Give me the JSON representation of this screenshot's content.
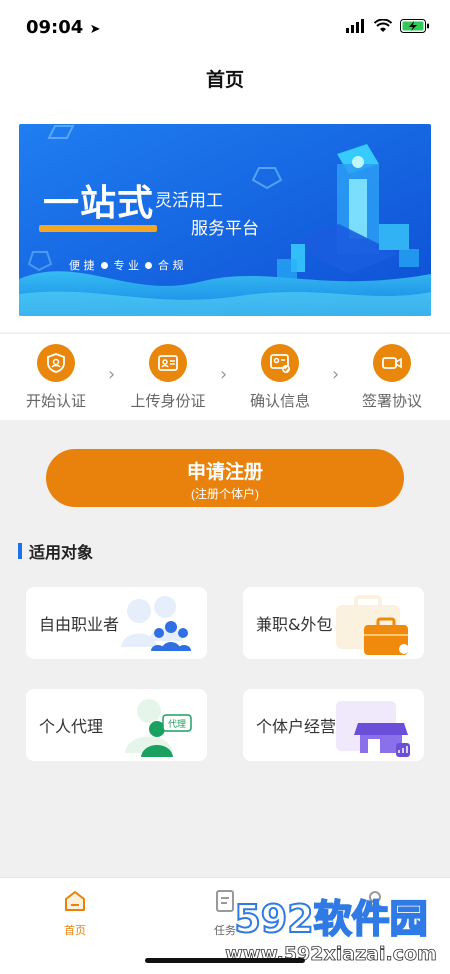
{
  "status_bar": {
    "time": "09:04"
  },
  "header": {
    "title": "首页"
  },
  "banner": {
    "headline": "一站式",
    "line1": "灵活用工",
    "line2": "服务平台",
    "tags": [
      "便 捷",
      "专 业",
      "合 规"
    ]
  },
  "steps": [
    {
      "label": "开始认证",
      "icon": "shield-user-icon"
    },
    {
      "label": "上传身份证",
      "icon": "id-card-icon"
    },
    {
      "label": "确认信息",
      "icon": "id-card-check-icon"
    },
    {
      "label": "签署协议",
      "icon": "video-icon"
    }
  ],
  "register": {
    "label": "申请注册",
    "sublabel": "(注册个体户)"
  },
  "section": {
    "title": "适用对象"
  },
  "targets": [
    {
      "label": "自由职业者",
      "icon": "people-group-icon"
    },
    {
      "label": "兼职&外包",
      "icon": "briefcase-icon"
    },
    {
      "label": "个人代理",
      "icon": "agent-icon",
      "badge": "代理"
    },
    {
      "label": "个体户经营者",
      "icon": "shop-icon"
    }
  ],
  "tabbar": {
    "items": [
      {
        "label": "首页",
        "icon": "home-icon",
        "active": true
      },
      {
        "label": "任务",
        "icon": "task-icon",
        "active": false
      },
      {
        "label": "",
        "icon": "user-icon",
        "active": false
      }
    ]
  },
  "watermark": {
    "brand": "592软件园",
    "url": "www.592xiazai.com"
  },
  "colors": {
    "accent": "#e8820c",
    "primary_blue": "#1a73e8",
    "banner_blue": "#1e6fe0"
  }
}
